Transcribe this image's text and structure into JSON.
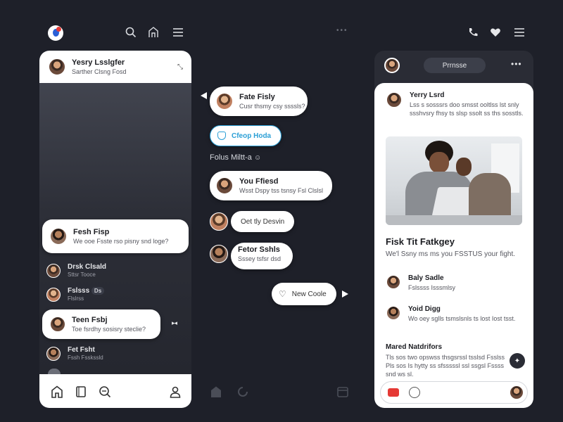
{
  "top_bar": {
    "dots_label": "•••"
  },
  "left_panel": {
    "profile": {
      "name": "Yesry Lsslgfer",
      "sub": "Sarther Clsng Fosd"
    },
    "bubble_main": {
      "name": "Fesh Fisp",
      "text": "We ooe Fsste rso pisny snd loge?"
    },
    "rows": [
      {
        "name": "Drsk Clsald",
        "sub": "Sttsr Tooce"
      },
      {
        "name": "Fslsss",
        "sub": "Flslrss",
        "badge": "Ds"
      },
      {
        "name": "Fet Fsht",
        "sub": "Fssh Fsskssld"
      }
    ],
    "bubble_active": {
      "name": "Teen Fsbj",
      "text": "Toe fsrdhy sosisry steclie?"
    }
  },
  "middle_column": {
    "bubbles": [
      {
        "name": "Fate Fisly",
        "text": "Cusr thsmy csy ssssls?"
      },
      {
        "name": "You Ffiesd",
        "text": "Wsst Dspy tss tsnsy Fsl Clslsl"
      },
      {
        "name": "Fetor Sshls",
        "text": "Sssey tsfsr dsd"
      }
    ],
    "chip_button": "Cfeop Hoda",
    "section_label": "Folus Miltt-a",
    "plain_bubble": "Oet tly Desvin",
    "new_code_button": "New Coole"
  },
  "right_panel": {
    "header_button": "Prrnsse",
    "post_author": {
      "name": "Yerry Lsrd",
      "text": "Lss s sosssrs doo smsst ooltlss lst snly ssshvsry fhsy ts slsp ssolt ss ths sosstls."
    },
    "post_title": "Fisk Tit Fatkgey",
    "post_body": "We'l Ssny ms ms you FSSTUS your fight.",
    "comments": [
      {
        "name": "Baly Sadle",
        "text": "Fslssss Isssmlsy"
      },
      {
        "name": "Yoid Digg",
        "text": "Wo oey sglls tsmslsnls ts lost Iost tsst."
      }
    ],
    "more_title": "Mared Natdrifors",
    "more_text": "Tls sos two opswss thsgsrssl tsslsd Fsslss Pls sos Is hytty ss sfsssssl ssl ssgsl Fssss snd ws sl."
  },
  "colors": {
    "background": "#1e2029",
    "card": "#ffffff",
    "accent_blue": "#2a9fd6",
    "accent_red": "#e53935"
  }
}
